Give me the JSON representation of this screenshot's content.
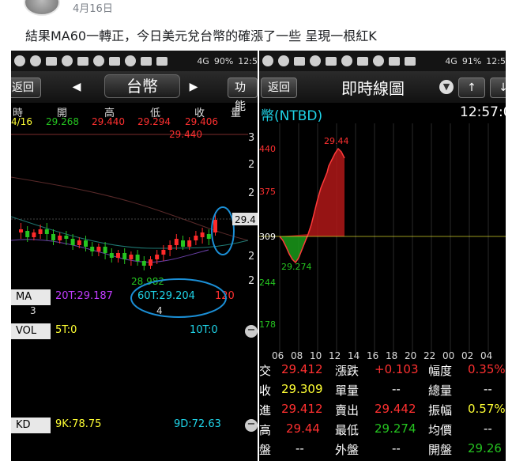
{
  "post": {
    "date": "4月16日",
    "text": "結果MA60一轉正，今日美元兌台幣的確漲了一些 呈現一根紅K"
  },
  "left": {
    "status": {
      "battery": "90%",
      "time": "12:5",
      "signal": "4G"
    },
    "header": {
      "back_label": "返回",
      "title": "台幣",
      "func_label": "功能"
    },
    "quote_labels": [
      "時",
      "開",
      "高",
      "低",
      "收",
      "量"
    ],
    "quote_values": [
      "4/16",
      "29.268",
      "29.440",
      "29.294",
      "29.406",
      ""
    ],
    "right_axis_labels": [
      "3",
      "2",
      "2",
      "29.4",
      "2",
      "2"
    ],
    "annotations": {
      "high": "29.440",
      "low": "28.982"
    },
    "ma": {
      "tag": "MA",
      "ma20": "20T:29.187",
      "ma60": "60T:29.204",
      "ma120": "120"
    },
    "x_labels": [
      "3",
      "4"
    ],
    "vol": {
      "tag": "VOL",
      "v5": "5T:0",
      "v10": "10T:0"
    },
    "kd": {
      "tag": "KD",
      "k": "9K:78.75",
      "d": "9D:72.63"
    },
    "colors": {
      "up": "#ff2a2a",
      "down": "#25c420",
      "ma20": "#c23cff",
      "ma60": "#1fd4e8",
      "circle": "#1b8fd6"
    }
  },
  "right": {
    "status": {
      "battery": "91%",
      "time": "12:5",
      "signal": "4G"
    },
    "header": {
      "back_label": "返回",
      "title": "即時線圖",
      "up_label": "↑",
      "down_label": "↓"
    },
    "symbol": "幣(NTBD)",
    "time": "12:57:0",
    "y_labels": [
      "440",
      "375",
      "309",
      "244",
      "178"
    ],
    "peak": "29.44",
    "trough": "29.274",
    "x_labels": [
      "06",
      "08",
      "10",
      "12",
      "14",
      "16",
      "18",
      "20",
      "22",
      "00",
      "02",
      "04"
    ],
    "table": [
      [
        {
          "t": "交",
          "c": "#fff"
        },
        {
          "t": "29.412",
          "c": "#ff3030"
        },
        {
          "t": "漲跌",
          "c": "#fff"
        },
        {
          "t": "+0.103",
          "c": "#ff3030"
        },
        {
          "t": "幅度",
          "c": "#fff"
        },
        {
          "t": "0.35%",
          "c": "#ff3030"
        }
      ],
      [
        {
          "t": "收",
          "c": "#fff"
        },
        {
          "t": "29.309",
          "c": "#ffff33"
        },
        {
          "t": "單量",
          "c": "#fff"
        },
        {
          "t": "--",
          "c": "#fff"
        },
        {
          "t": "總量",
          "c": "#fff"
        },
        {
          "t": "--",
          "c": "#fff"
        }
      ],
      [
        {
          "t": "進",
          "c": "#fff"
        },
        {
          "t": "29.412",
          "c": "#ff3030"
        },
        {
          "t": "賣出",
          "c": "#fff"
        },
        {
          "t": "29.442",
          "c": "#ff3030"
        },
        {
          "t": "振幅",
          "c": "#fff"
        },
        {
          "t": "0.57%",
          "c": "#ffff33"
        }
      ],
      [
        {
          "t": "高",
          "c": "#fff"
        },
        {
          "t": "29.44",
          "c": "#ff3030"
        },
        {
          "t": "最低",
          "c": "#fff"
        },
        {
          "t": "29.274",
          "c": "#25c420"
        },
        {
          "t": "均價",
          "c": "#fff"
        },
        {
          "t": "--",
          "c": "#fff"
        }
      ],
      [
        {
          "t": "盤",
          "c": "#fff"
        },
        {
          "t": "--",
          "c": "#fff"
        },
        {
          "t": "外盤",
          "c": "#fff"
        },
        {
          "t": "--",
          "c": "#fff"
        },
        {
          "t": "開盤",
          "c": "#fff"
        },
        {
          "t": "29.26",
          "c": "#25c420"
        }
      ]
    ]
  }
}
